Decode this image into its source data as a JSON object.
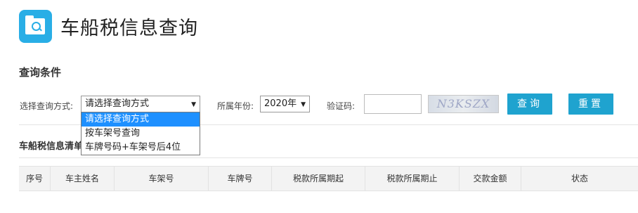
{
  "header": {
    "title": "车船税信息查询",
    "logo_icon": "folder-search-icon",
    "logo_color": "#29aee6"
  },
  "query": {
    "section_title": "查询条件",
    "method_label": "选择查询方式:",
    "method_value": "请选择查询方式",
    "method_options": [
      "请选择查询方式",
      "按车架号查询",
      "车牌号码+车架号后4位"
    ],
    "year_label": "所属年份:",
    "year_value": "2020年",
    "captcha_label": "验证码:",
    "captcha_value": "",
    "captcha_text": "N3KSZX",
    "query_button": "查询",
    "reset_button": "重置",
    "button_color": "#1fa3cf"
  },
  "results": {
    "section_title": "车船税信息清单",
    "columns": [
      "序号",
      "车主姓名",
      "车架号",
      "车牌号",
      "税款所属期起",
      "税款所属期止",
      "交款金额",
      "状态"
    ]
  }
}
